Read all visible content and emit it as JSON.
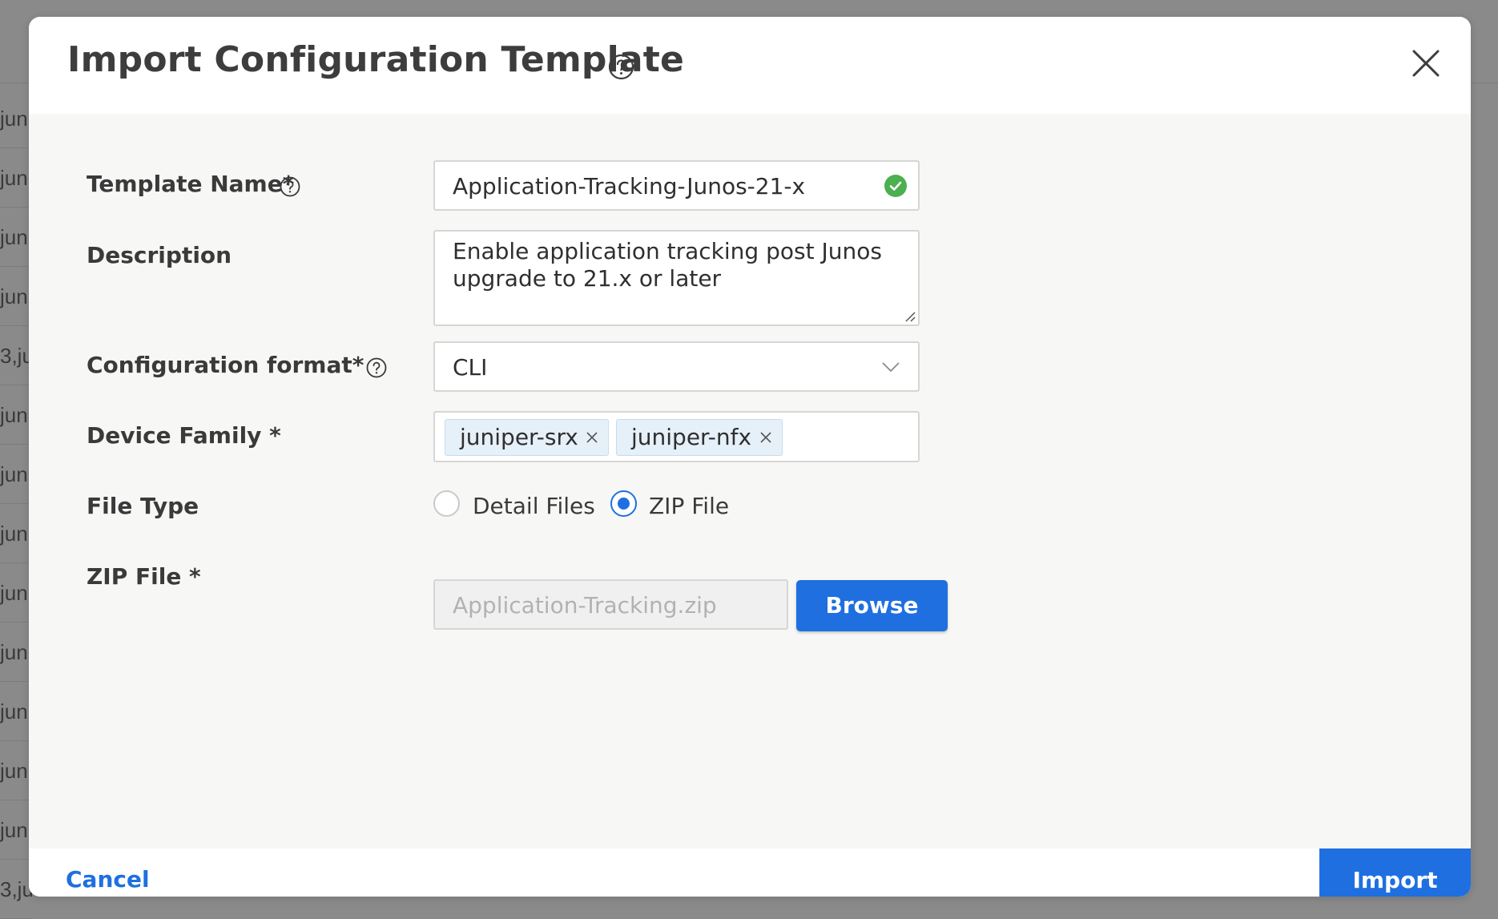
{
  "background": {
    "rows": [
      "jun",
      "jun",
      "jun",
      "jun",
      "3,ju",
      "jun",
      "jun",
      "jun",
      "jun",
      "jun",
      "jun",
      "jun",
      "jun",
      "3,ju"
    ]
  },
  "modal": {
    "title": "Import Configuration Template",
    "fields": {
      "template_name": {
        "label": "Template Name*",
        "value": "Application-Tracking-Junos-21-x"
      },
      "description": {
        "label": "Description",
        "value": "Enable application tracking post Junos upgrade to 21.x or later"
      },
      "config_format": {
        "label": "Configuration format*",
        "value": "CLI"
      },
      "device_family": {
        "label": "Device Family *",
        "tags": [
          "juniper-srx",
          "juniper-nfx"
        ]
      },
      "file_type": {
        "label": "File Type",
        "options": [
          "Detail Files",
          "ZIP File"
        ],
        "selected": "ZIP File"
      },
      "zip_file": {
        "label": "ZIP File *",
        "placeholder": "Application-Tracking.zip",
        "browse_label": "Browse"
      }
    },
    "footer": {
      "cancel_label": "Cancel",
      "import_label": "Import"
    }
  },
  "colors": {
    "accent": "#1f6fe0",
    "valid": "#4caf50"
  }
}
